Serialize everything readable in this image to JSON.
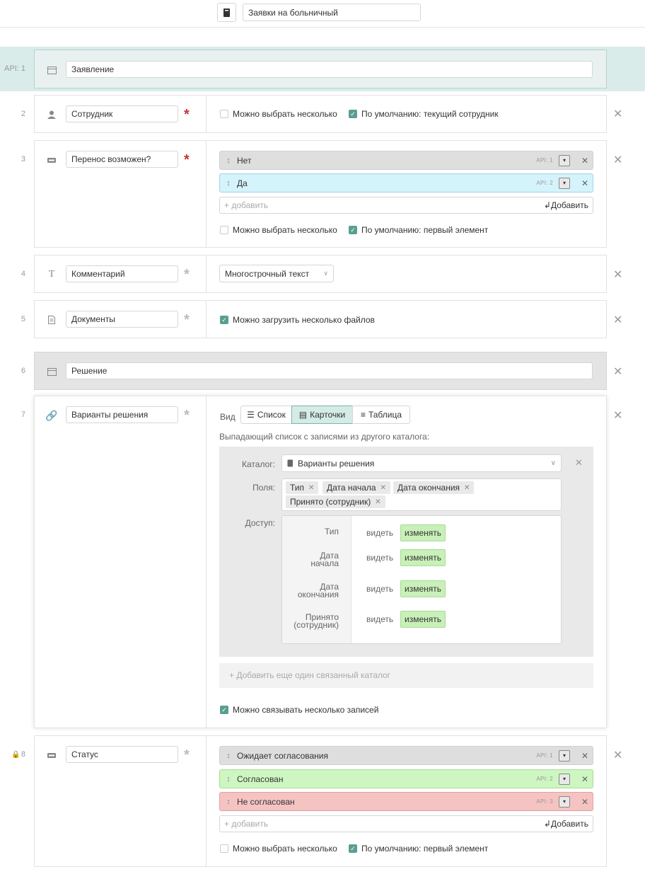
{
  "header": {
    "catalog_icon": "book-icon",
    "title": "Заявки на больничный"
  },
  "fields": [
    {
      "num": "API: 1",
      "icon": "section-icon",
      "name": "Заявление"
    },
    {
      "num": "2",
      "icon": "user-icon",
      "name": "Сотрудник",
      "multi_label": "Можно выбрать несколько",
      "default_label": "По умолчанию: текущий сотрудник"
    },
    {
      "num": "3",
      "icon": "category-icon",
      "name": "Перенос возможен?",
      "options": [
        {
          "label": "Нет",
          "api": "API: 1",
          "color": "#dedede"
        },
        {
          "label": "Да",
          "api": "API: 2",
          "color": "#d5f3fb"
        }
      ],
      "add_placeholder": "+ добавить",
      "add_button": "Добавить",
      "multi_label": "Можно выбрать несколько",
      "default_label": "По умолчанию: первый элемент"
    },
    {
      "num": "4",
      "icon": "text-icon",
      "name": "Комментарий",
      "type_select": "Многострочный текст"
    },
    {
      "num": "5",
      "icon": "document-icon",
      "name": "Документы",
      "multi_label": "Можно загрузить несколько файлов"
    },
    {
      "num": "6",
      "icon": "section-icon",
      "name": "Решение"
    },
    {
      "num": "7",
      "icon": "link-icon",
      "name": "Варианты решения",
      "view_label": "Вид",
      "view_options": [
        "Список",
        "Карточки",
        "Таблица"
      ],
      "desc": "Выпадающий список с записями из другого каталога:",
      "catalog_label": "Каталог:",
      "catalog_value": "Варианты решения",
      "fields_label": "Поля:",
      "chips": [
        "Тип",
        "Дата начала",
        "Дата окончания",
        "Принято (сотрудник)"
      ],
      "access_label": "Доступ:",
      "access": [
        {
          "name": "Тип",
          "see": "видеть",
          "edit": "изменять"
        },
        {
          "name": "Дата начала",
          "see": "видеть",
          "edit": "изменять"
        },
        {
          "name": "Дата окончания",
          "see": "видеть",
          "edit": "изменять"
        },
        {
          "name": "Принято (сотрудник)",
          "see": "видеть",
          "edit": "изменять"
        }
      ],
      "add_catalog": "+ Добавить еще один связанный каталог",
      "multi_label": "Можно связывать несколько записей"
    },
    {
      "num": "8",
      "icon": "category-icon",
      "name": "Статус",
      "options": [
        {
          "label": "Ожидает согласования",
          "api": "API: 1",
          "color": "#dedede"
        },
        {
          "label": "Согласован",
          "api": "API: 2",
          "color": "#cdf6c1"
        },
        {
          "label": "Не согласован",
          "api": "API: 3",
          "color": "#f6c3c3"
        }
      ],
      "add_placeholder": "+ добавить",
      "add_button": "Добавить",
      "multi_label": "Можно выбрать несколько",
      "default_label": "По умолчанию: первый элемент"
    }
  ],
  "colors": {
    "accent": "#5a9e92",
    "required": "#c9343b",
    "highlight_row": "#d9ecea"
  }
}
